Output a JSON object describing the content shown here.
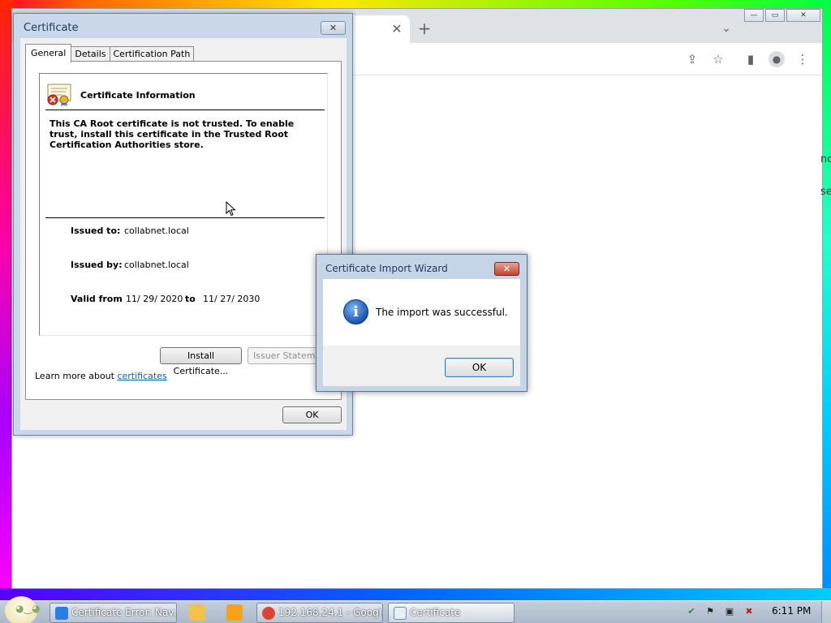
{
  "chrome": {
    "tab_close": "✕",
    "new_tab": "+",
    "tab_search": "⌄",
    "side_text": [
      "no",
      "se"
    ]
  },
  "window_controls": {
    "minimize": "—",
    "restore": "▭",
    "close": "✕"
  },
  "certificate_dialog": {
    "title": "Certificate",
    "close": "✕",
    "tabs": [
      "General",
      "Details",
      "Certification Path"
    ],
    "active_tab": "General",
    "heading": "Certificate Information",
    "warning": "This CA Root certificate is not trusted. To enable trust, install this certificate in the Trusted Root Certification Authorities store.",
    "issued_to_label": "Issued to:",
    "issued_to_value": "collabnet.local",
    "issued_by_label": "Issued by:",
    "issued_by_value": "collabnet.local",
    "valid_from_label": "Valid from",
    "valid_from_value": "11/ 29/ 2020",
    "to_label": "to",
    "valid_to_value": "11/ 27/ 2030",
    "install_button": "Install Certificate...",
    "issuer_statement_button": "Issuer Statement",
    "learn_more_prefix": "Learn more about",
    "learn_more_link": "certificates",
    "ok_button": "OK"
  },
  "import_wizard": {
    "title": "Certificate Import Wizard",
    "close": "✕",
    "message": "The import was successful.",
    "ok_button": "OK"
  },
  "taskbar": {
    "items": [
      {
        "label": "Certificate Error: Nav...",
        "icon": "ie-icon",
        "color": "#2a7de1"
      },
      {
        "label": "192.168.24.1 - Googl...",
        "icon": "chrome-icon",
        "color": "#db4437"
      },
      {
        "label": "Certificate",
        "icon": "document-icon",
        "color": "#e6eef8"
      }
    ],
    "clock": "6:11 PM"
  }
}
